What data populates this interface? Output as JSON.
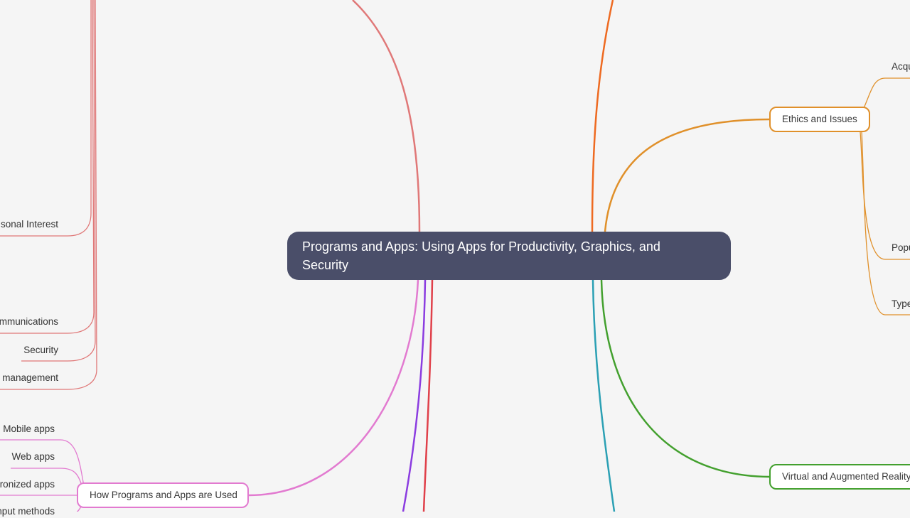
{
  "root": {
    "title": "Programs and Apps: Using Apps for Productivity, Graphics, and Security"
  },
  "branches": {
    "ethics": {
      "label": "Ethics and Issues",
      "color": "#e0902a",
      "leaves": [
        "Acqu",
        "Popu",
        "Type"
      ]
    },
    "vr": {
      "label": "Virtual and Augmented Reality",
      "color": "#43a02e"
    },
    "used": {
      "label": "How Programs and Apps are Used",
      "color": "#e27ad0",
      "leaves": [
        "Mobile apps",
        "Web apps",
        "ronized apps",
        "nput methods"
      ]
    },
    "categories": {
      "color": "#e07878",
      "leaves": [
        "sonal Interest",
        "mmunications",
        "Security",
        "management"
      ]
    },
    "other_colors": [
      "#ee6a21",
      "#2ba0b4",
      "#8b3ce0",
      "#e0404a"
    ]
  }
}
